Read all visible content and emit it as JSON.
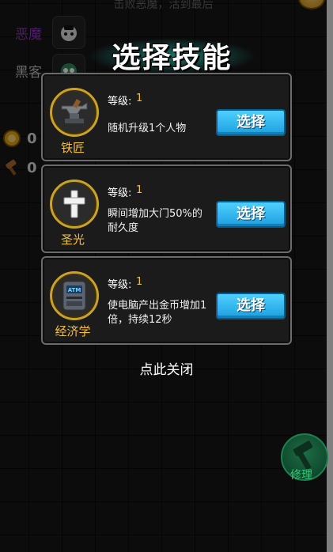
{
  "top_hint": "击败恶魔，活到最后",
  "players": [
    {
      "name": "恶魔",
      "color": "#8a3ab9"
    },
    {
      "name": "黑客",
      "color": "#bdbdbd"
    }
  ],
  "side_stats": {
    "coins": "0",
    "hammers": "0"
  },
  "dialog": {
    "title": "选择技能",
    "level_label": "等级:",
    "skills": [
      {
        "name": "铁匠",
        "icon": "anvil-icon",
        "level": "1",
        "description": "随机升级1个人物",
        "button": "选择"
      },
      {
        "name": "圣光",
        "icon": "holy-cross-icon",
        "level": "1",
        "description": "瞬间增加大门50%的耐久度",
        "button": "选择"
      },
      {
        "name": "经济学",
        "icon": "atm-icon",
        "level": "1",
        "description": "使电脑产出金币增加1倍，持续12秒",
        "button": "选择"
      }
    ],
    "close_label": "点此关闭"
  },
  "repair": {
    "label": "修理"
  },
  "colors": {
    "accent_gold": "#f4c03b",
    "button_blue": "#2bb5f0"
  }
}
